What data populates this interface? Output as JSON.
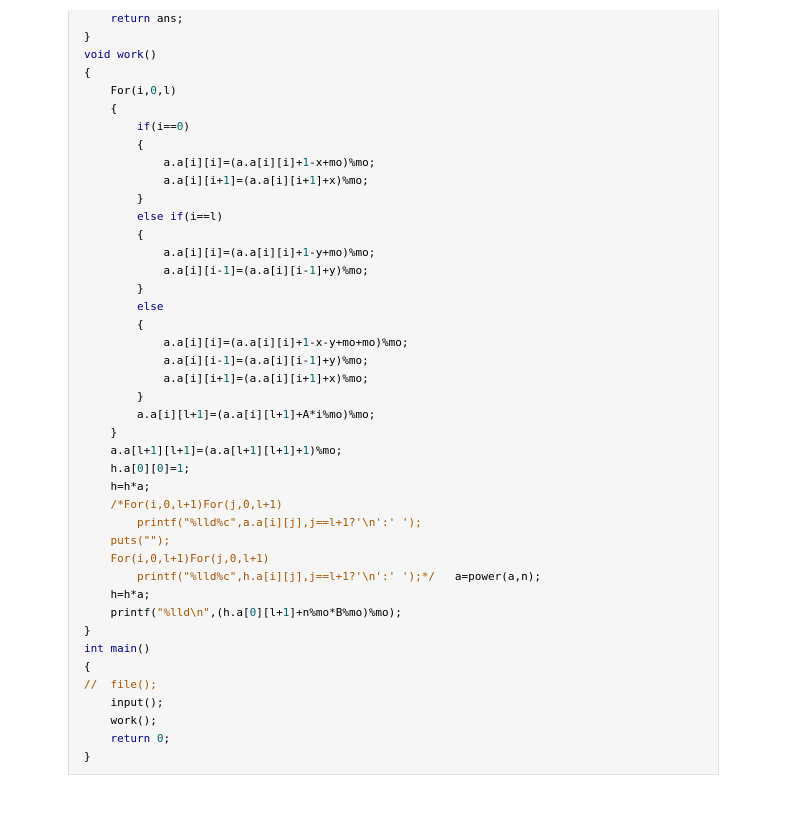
{
  "code": {
    "lines": [
      "    return ans;",
      "}",
      "void work()",
      "{",
      "    For(i,0,l)",
      "    {",
      "        if(i==0)",
      "        {",
      "            a.a[i][i]=(a.a[i][i]+1-x+mo)%mo;",
      "            a.a[i][i+1]=(a.a[i][i+1]+x)%mo;",
      "        }",
      "        else if(i==l)",
      "        {",
      "            a.a[i][i]=(a.a[i][i]+1-y+mo)%mo;",
      "            a.a[i][i-1]=(a.a[i][i-1]+y)%mo;",
      "        }",
      "        else",
      "        {",
      "            a.a[i][i]=(a.a[i][i]+1-x-y+mo+mo)%mo;",
      "            a.a[i][i-1]=(a.a[i][i-1]+y)%mo;",
      "            a.a[i][i+1]=(a.a[i][i+1]+x)%mo;",
      "        }",
      "        a.a[i][l+1]=(a.a[i][l+1]+A*i%mo)%mo;",
      "    }",
      "    a.a[l+1][l+1]=(a.a[l+1][l+1]+1)%mo;",
      "    h.a[0][0]=1;",
      "    h=h*a;",
      "    /*For(i,0,l+1)For(j,0,l+1)",
      "        printf(\"%lld%c\",a.a[i][j],j==l+1?'\\n':' ');",
      "    puts(\"\");",
      "    For(i,0,l+1)For(j,0,l+1)",
      "        printf(\"%lld%c\",h.a[i][j],j==l+1?'\\n':' ');*/   a=power(a,n);",
      "    h=h*a;",
      "    printf(\"%lld\\n\",(h.a[0][l+1]+n%mo*B%mo)%mo);",
      "}",
      "int main()",
      "{",
      "//  file();",
      "    input();",
      "    work();",
      "    return 0;",
      "}"
    ]
  }
}
